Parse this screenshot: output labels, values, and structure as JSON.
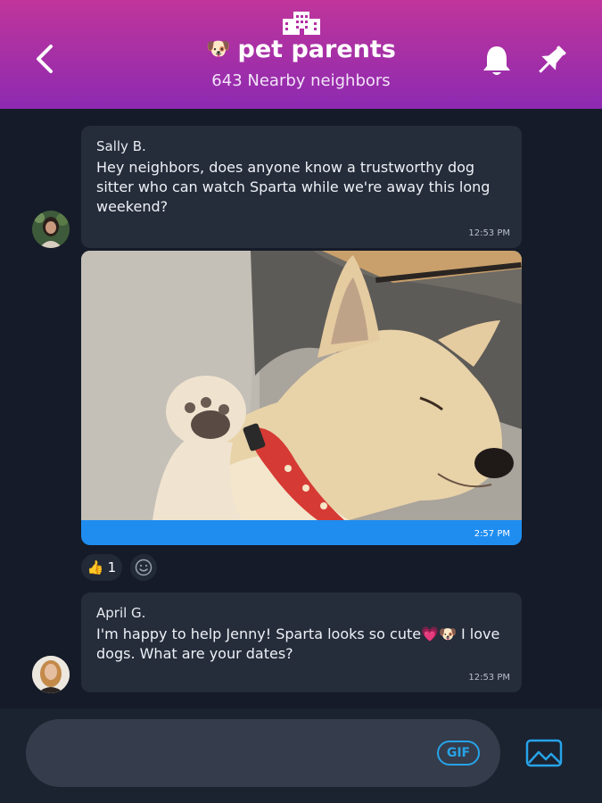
{
  "header": {
    "title_emoji": "🐶",
    "title": "pet parents",
    "subtitle": "643 Nearby neighbors"
  },
  "messages": [
    {
      "sender": "Sally B.",
      "text": "Hey neighbors, does anyone know a trustworthy dog sitter who can watch Sparta while we're away this long weekend?",
      "time": "12:53 PM"
    },
    {
      "type": "photo",
      "photo_subject": "dog-photo",
      "time": "2:57 PM",
      "reaction_emoji": "👍",
      "reaction_count": "1"
    },
    {
      "sender": "April G.",
      "text": "I'm happy to help Jenny! Sparta looks so cute💗🐶 I love dogs. What are your dates?",
      "time": "12:53 PM"
    }
  ],
  "composer": {
    "placeholder": "",
    "gif_label": "GIF"
  },
  "colors": {
    "header_top": "#c0359b",
    "header_bottom": "#8d2ab1",
    "background": "#151b28",
    "bubble": "#252c3a",
    "photo_footer": "#1f8df0",
    "accent": "#27a3e8"
  },
  "icons": [
    "back-arrow-icon",
    "building-icon",
    "bell-icon",
    "pin-icon",
    "smiley-add-icon",
    "image-icon"
  ]
}
